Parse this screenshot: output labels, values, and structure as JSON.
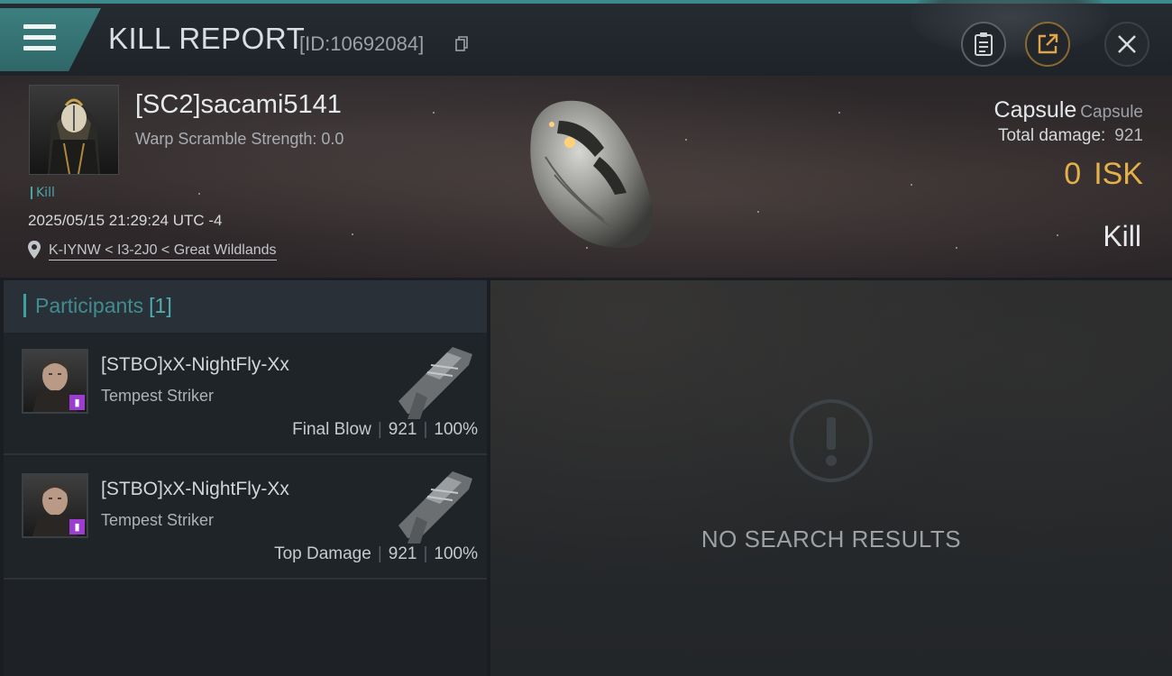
{
  "header": {
    "title": "KILL REPORT",
    "report_id": "[ID:10692084]"
  },
  "victim": {
    "name": "[SC2]sacami5141",
    "warp_scramble": "Warp Scramble Strength: 0.0",
    "tag": "Kill",
    "datetime": "2025/05/15 21:29:24 UTC -4",
    "location": "K-IYNW < I3-2J0 < Great Wildlands",
    "ship_name": "Capsule",
    "ship_type": "Capsule",
    "total_damage_label": "Total damage:",
    "total_damage": "921",
    "isk_value": "0",
    "isk_unit": "ISK",
    "kill_label": "Kill"
  },
  "participants": {
    "title": "Participants",
    "count": "[1]",
    "rows": [
      {
        "name": "[STBO]xX-NightFly-Xx",
        "ship": "Tempest Striker",
        "role": "Final Blow",
        "damage": "921",
        "percent": "100%"
      },
      {
        "name": "[STBO]xX-NightFly-Xx",
        "ship": "Tempest Striker",
        "role": "Top Damage",
        "damage": "921",
        "percent": "100%"
      }
    ]
  },
  "results": {
    "empty_text": "NO SEARCH RESULTS"
  },
  "colors": {
    "accent": "#3d8a8c",
    "isk": "#e5b04a",
    "badge": "#9a3dd0"
  },
  "icons": [
    "menu-icon",
    "copy-icon",
    "clipboard-icon",
    "share-icon",
    "close-icon",
    "location-pin-icon",
    "exclamation-icon"
  ]
}
